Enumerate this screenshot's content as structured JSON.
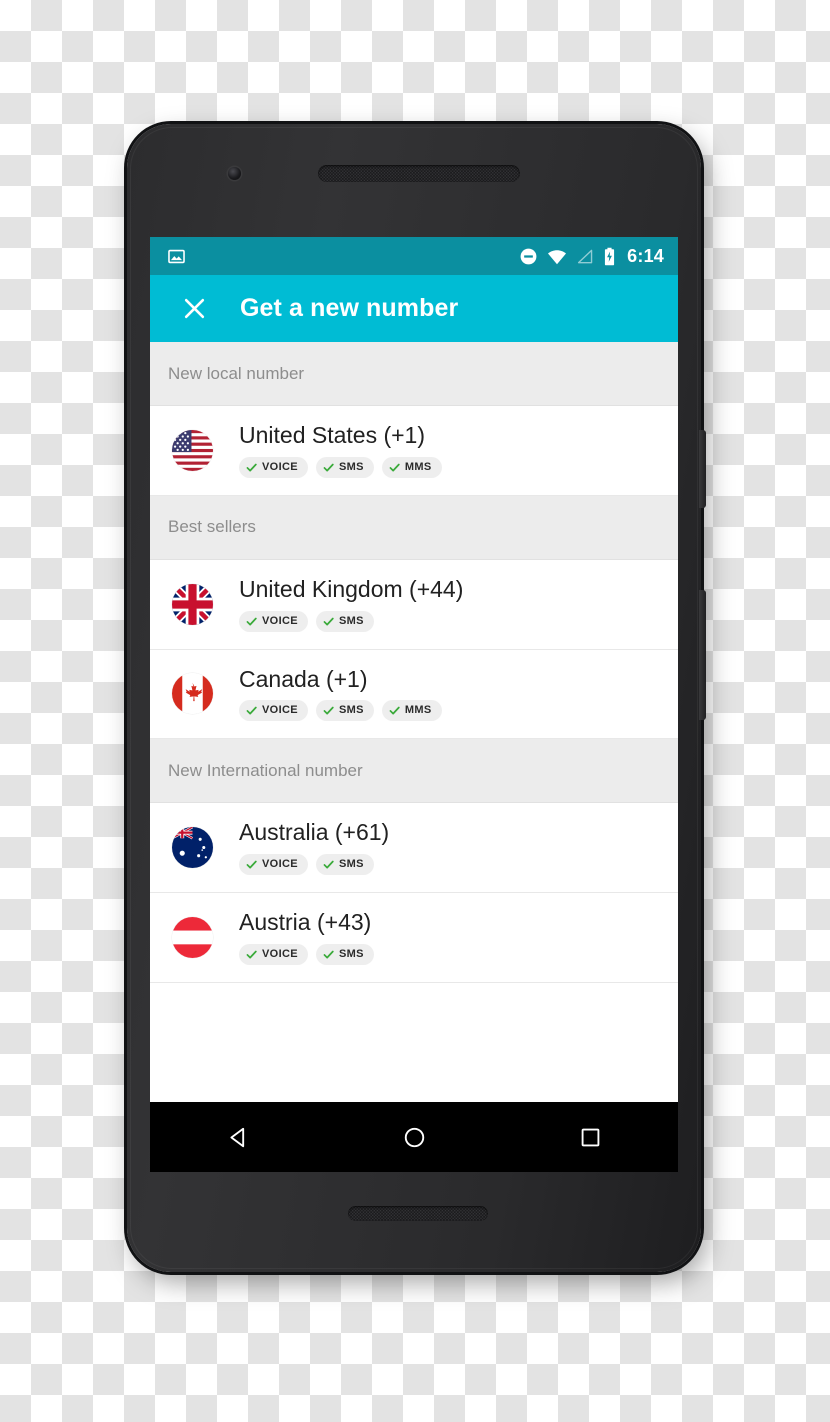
{
  "status_bar": {
    "time": "6:14",
    "icons": {
      "notification": "image-icon",
      "dnd": "do-not-disturb-icon",
      "wifi": "wifi-icon",
      "signal": "cellular-signal-icon",
      "battery": "battery-charging-icon"
    },
    "background_color": "#0b8fa0"
  },
  "app_bar": {
    "close_icon": "close-icon",
    "title": "Get a new number",
    "background_color": "#00bcd4",
    "text_color": "#ffffff"
  },
  "sections": [
    {
      "header": "New local number",
      "rows": [
        {
          "flag": "flag-united-states",
          "name": "United States (+1)",
          "capabilities": [
            "VOICE",
            "SMS",
            "MMS"
          ]
        }
      ]
    },
    {
      "header": "Best sellers",
      "rows": [
        {
          "flag": "flag-united-kingdom",
          "name": "United Kingdom (+44)",
          "capabilities": [
            "VOICE",
            "SMS"
          ]
        },
        {
          "flag": "flag-canada",
          "name": "Canada (+1)",
          "capabilities": [
            "VOICE",
            "SMS",
            "MMS"
          ]
        }
      ]
    },
    {
      "header": "New International number",
      "rows": [
        {
          "flag": "flag-australia",
          "name": "Australia (+61)",
          "capabilities": [
            "VOICE",
            "SMS"
          ]
        },
        {
          "flag": "flag-austria",
          "name": "Austria (+43)",
          "capabilities": [
            "VOICE",
            "SMS"
          ]
        }
      ]
    }
  ],
  "nav_bar": {
    "back": "back-triangle-icon",
    "home": "home-circle-icon",
    "recents": "recents-square-icon"
  },
  "colors": {
    "accent": "#00bcd4",
    "status_bar": "#0b8fa0",
    "section_header_bg": "#ececec",
    "section_header_text": "#8d8d8d",
    "chip_bg": "#eeeeee",
    "check_green": "#3aaa3a",
    "row_text": "#212121"
  }
}
